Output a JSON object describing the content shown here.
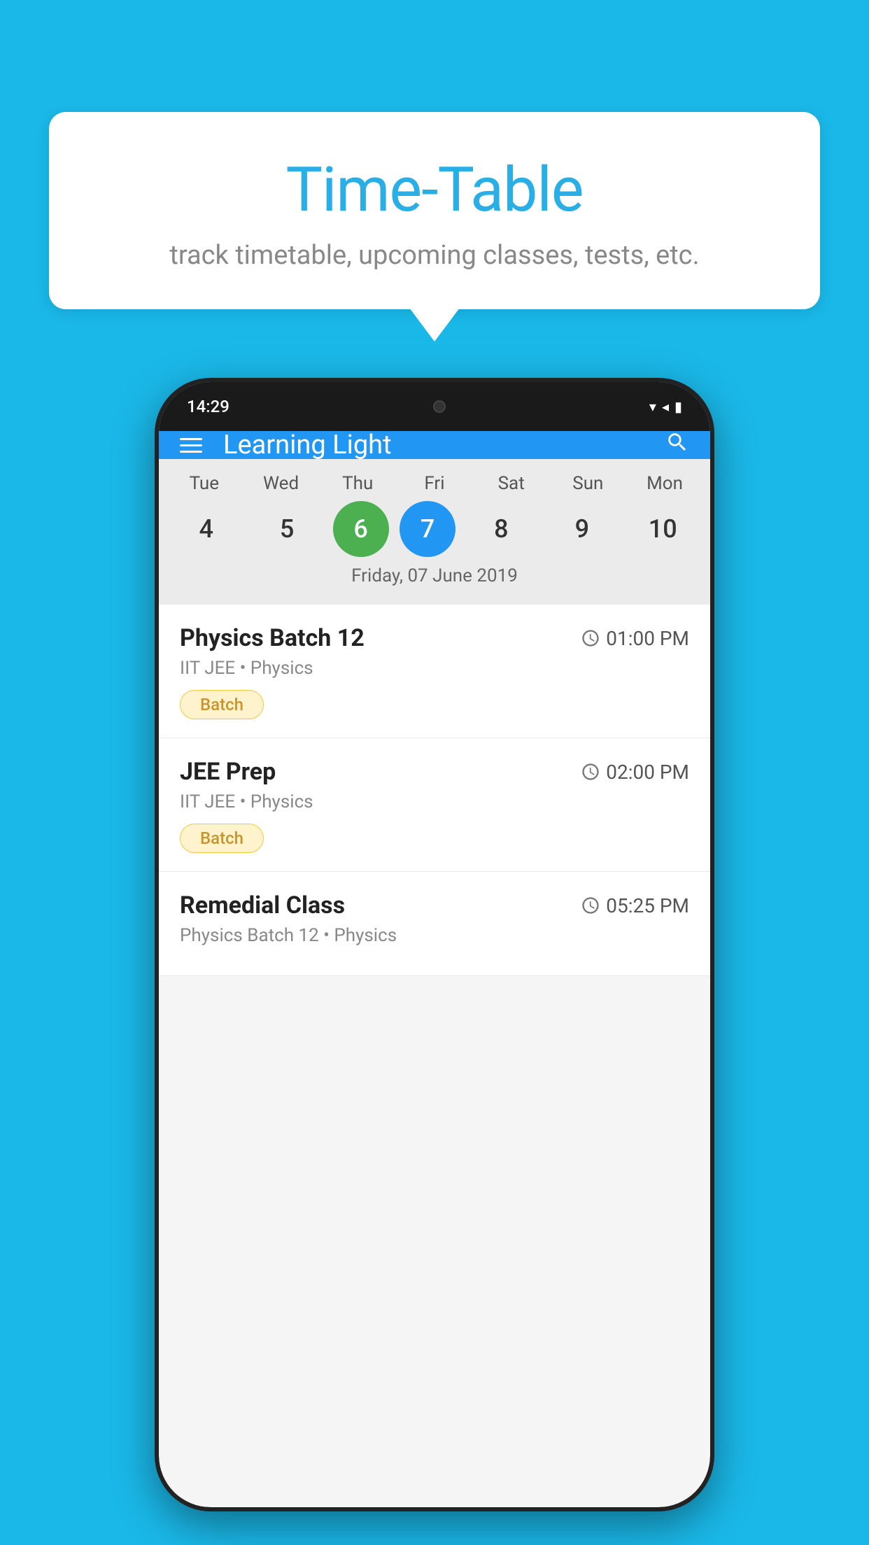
{
  "background_color": "#1ab8e8",
  "bubble": {
    "title": "Time-Table",
    "subtitle": "track timetable, upcoming classes, tests, etc."
  },
  "status_bar": {
    "time": "14:29",
    "icons": [
      "▼",
      "◄",
      "▮"
    ]
  },
  "app_bar": {
    "title": "Learning Light",
    "menu_icon": "menu",
    "search_icon": "search"
  },
  "calendar": {
    "days": [
      {
        "label": "Tue",
        "number": "4"
      },
      {
        "label": "Wed",
        "number": "5"
      },
      {
        "label": "Thu",
        "number": "6",
        "state": "today"
      },
      {
        "label": "Fri",
        "number": "7",
        "state": "selected"
      },
      {
        "label": "Sat",
        "number": "8"
      },
      {
        "label": "Sun",
        "number": "9"
      },
      {
        "label": "Mon",
        "number": "10"
      }
    ],
    "selected_date_label": "Friday, 07 June 2019"
  },
  "classes": [
    {
      "name": "Physics Batch 12",
      "time": "01:00 PM",
      "meta": "IIT JEE • Physics",
      "tag": "Batch"
    },
    {
      "name": "JEE Prep",
      "time": "02:00 PM",
      "meta": "IIT JEE • Physics",
      "tag": "Batch"
    },
    {
      "name": "Remedial Class",
      "time": "05:25 PM",
      "meta": "Physics Batch 12 • Physics",
      "tag": ""
    }
  ]
}
